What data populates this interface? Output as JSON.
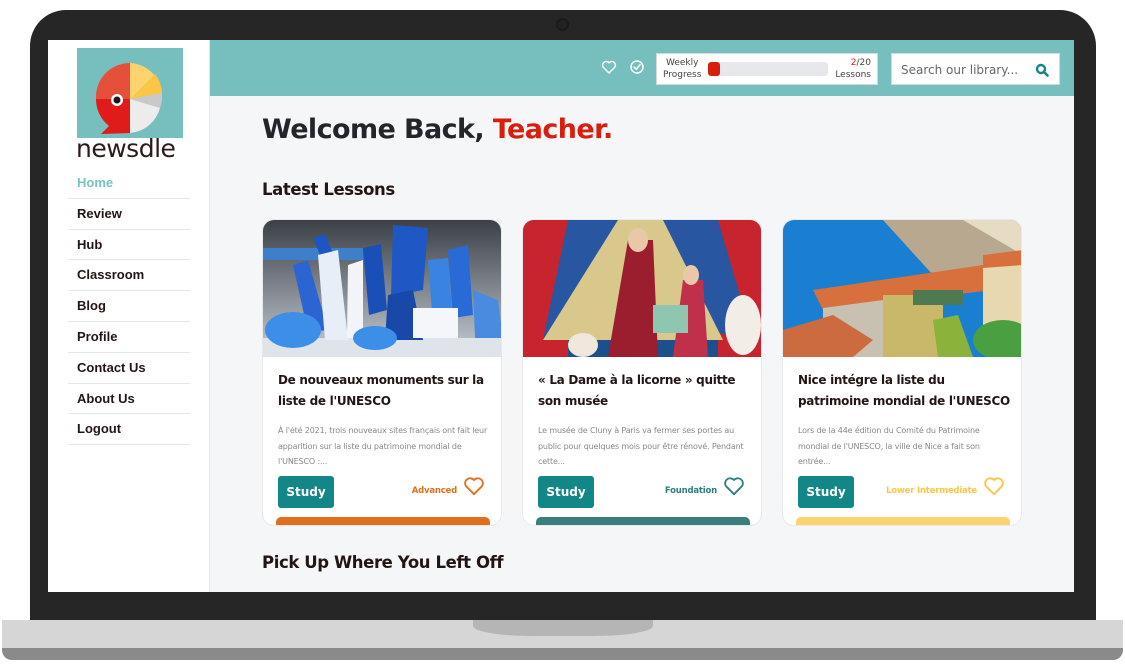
{
  "app": {
    "brand": "newsdle"
  },
  "sidebar": {
    "items": [
      {
        "label": "Home",
        "active": true
      },
      {
        "label": "Review"
      },
      {
        "label": "Hub"
      },
      {
        "label": "Classroom"
      },
      {
        "label": "Blog"
      },
      {
        "label": "Profile"
      },
      {
        "label": "Contact Us"
      },
      {
        "label": "About Us"
      },
      {
        "label": "Logout"
      }
    ]
  },
  "topbar": {
    "icons": [
      "heart-icon",
      "check-circle-icon"
    ],
    "progress": {
      "label_line1": "Weekly",
      "label_line2": "Progress",
      "done": "2",
      "total": "/20",
      "unit": "Lessons",
      "fraction": 0.1
    },
    "search": {
      "placeholder": "Search our library...",
      "value": ""
    }
  },
  "main": {
    "welcome_prefix": "Welcome Back, ",
    "welcome_name": "Teacher.",
    "latest_title": "Latest Lessons",
    "continue_title": "Pick Up Where You Left Off",
    "lessons": [
      {
        "title": "De nouveaux monuments sur la liste de l'UNESCO",
        "description": "À l'été 2021, trois nouveaux sites français ont fait leur apparition sur la liste du patrimoine mondial de l'UNESCO :...",
        "button": "Study",
        "level": "Advanced",
        "level_color": "#e0701c",
        "image": "blue-cardboard-city-skyline"
      },
      {
        "title": "« La Dame à la licorne » quitte son musée",
        "description": "Le musée de Cluny à Paris va fermer ses portes au public pour quelques mois pour être rénové. Pendant cette...",
        "button": "Study",
        "level": "Foundation",
        "level_color": "#2f7d7d",
        "image": "lady-and-unicorn-tapestry"
      },
      {
        "title": "Nice intégre la liste du patrimoine mondial de l'UNESCO",
        "description": "Lors de la 44e édition du Comité du Patrimoine mondial de l'UNESCO, la ville de Nice a fait son entrée...",
        "button": "Study",
        "level": "Lower Intermediate",
        "level_color": "#fbc646",
        "image": "nice-coastline-rooftops"
      }
    ]
  },
  "colors": {
    "teal": "#77bfbf",
    "accent_red": "#d91e0d",
    "button": "#138688"
  }
}
